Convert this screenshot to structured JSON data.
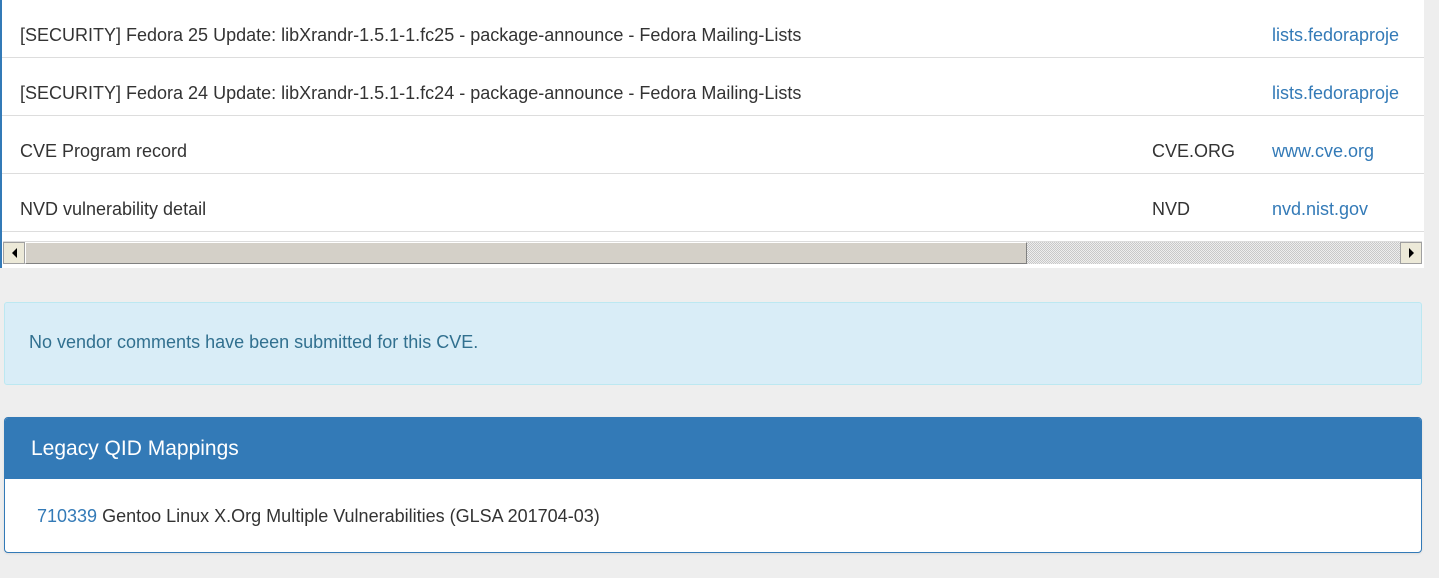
{
  "references": {
    "rows": [
      {
        "title": "[SECURITY] Fedora 25 Update: libXrandr-1.5.1-1.fc25 - package-announce - Fedora Mailing-Lists",
        "source": "",
        "link": "lists.fedoraproje"
      },
      {
        "title": "[SECURITY] Fedora 24 Update: libXrandr-1.5.1-1.fc24 - package-announce - Fedora Mailing-Lists",
        "source": "",
        "link": "lists.fedoraproje"
      },
      {
        "title": "CVE Program record",
        "source": "CVE.ORG",
        "link": "www.cve.org"
      },
      {
        "title": "NVD vulnerability detail",
        "source": "NVD",
        "link": "nvd.nist.gov"
      }
    ]
  },
  "vendor_comments": {
    "message": "No vendor comments have been submitted for this CVE."
  },
  "legacy_qid": {
    "heading": "Legacy QID Mappings",
    "items": [
      {
        "qid": "710339",
        "description": "Gentoo Linux X.Org Multiple Vulnerabilities (GLSA 201704-03)"
      }
    ]
  },
  "colors": {
    "accent": "#337ab7",
    "alert_bg": "#d9edf7",
    "alert_text": "#31708f",
    "page_bg": "#eeeeee"
  }
}
